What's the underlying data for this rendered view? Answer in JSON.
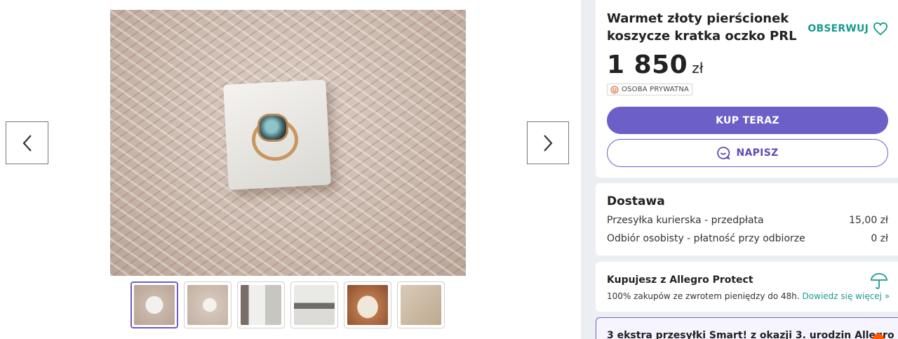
{
  "product": {
    "title": "Warmet złoty pierścionek koszycze kratka oczko PRL",
    "watch_label": "OBSERWUJ",
    "price_value": "1 850",
    "price_currency": "zł",
    "seller_type": "OSOBA PRYWATNA",
    "buy_label": "KUP TERAZ",
    "message_label": "NAPISZ"
  },
  "delivery": {
    "title": "Dostawa",
    "options": [
      {
        "name": "Przesyłka kurierska - przedpłata",
        "price": "15,00 zł"
      },
      {
        "name": "Odbiór osobisty - płatność przy odbiorze",
        "price": "0 zł"
      }
    ]
  },
  "protect": {
    "title": "Kupujesz z Allegro Protect",
    "text": "100% zakupów ze zwrotem pieniędzy do 48h.",
    "link": "Dowiedz się więcej »"
  },
  "promo": {
    "text": "3 ekstra przesyłki Smart! z okazji 3. urodzin Allegro"
  },
  "gallery": {
    "thumb_count": 6,
    "active_index": 0
  },
  "colors": {
    "accent": "#6c5fc7",
    "teal": "#1a9a8f",
    "promo_dot": "#ff5a00",
    "background": "#eceff1"
  },
  "icons": {
    "prev": "chevron-left-icon",
    "next": "chevron-right-icon",
    "watch": "heart-icon",
    "seller": "smiley-icon",
    "message": "chat-bubble-icon",
    "protect": "umbrella-icon"
  }
}
